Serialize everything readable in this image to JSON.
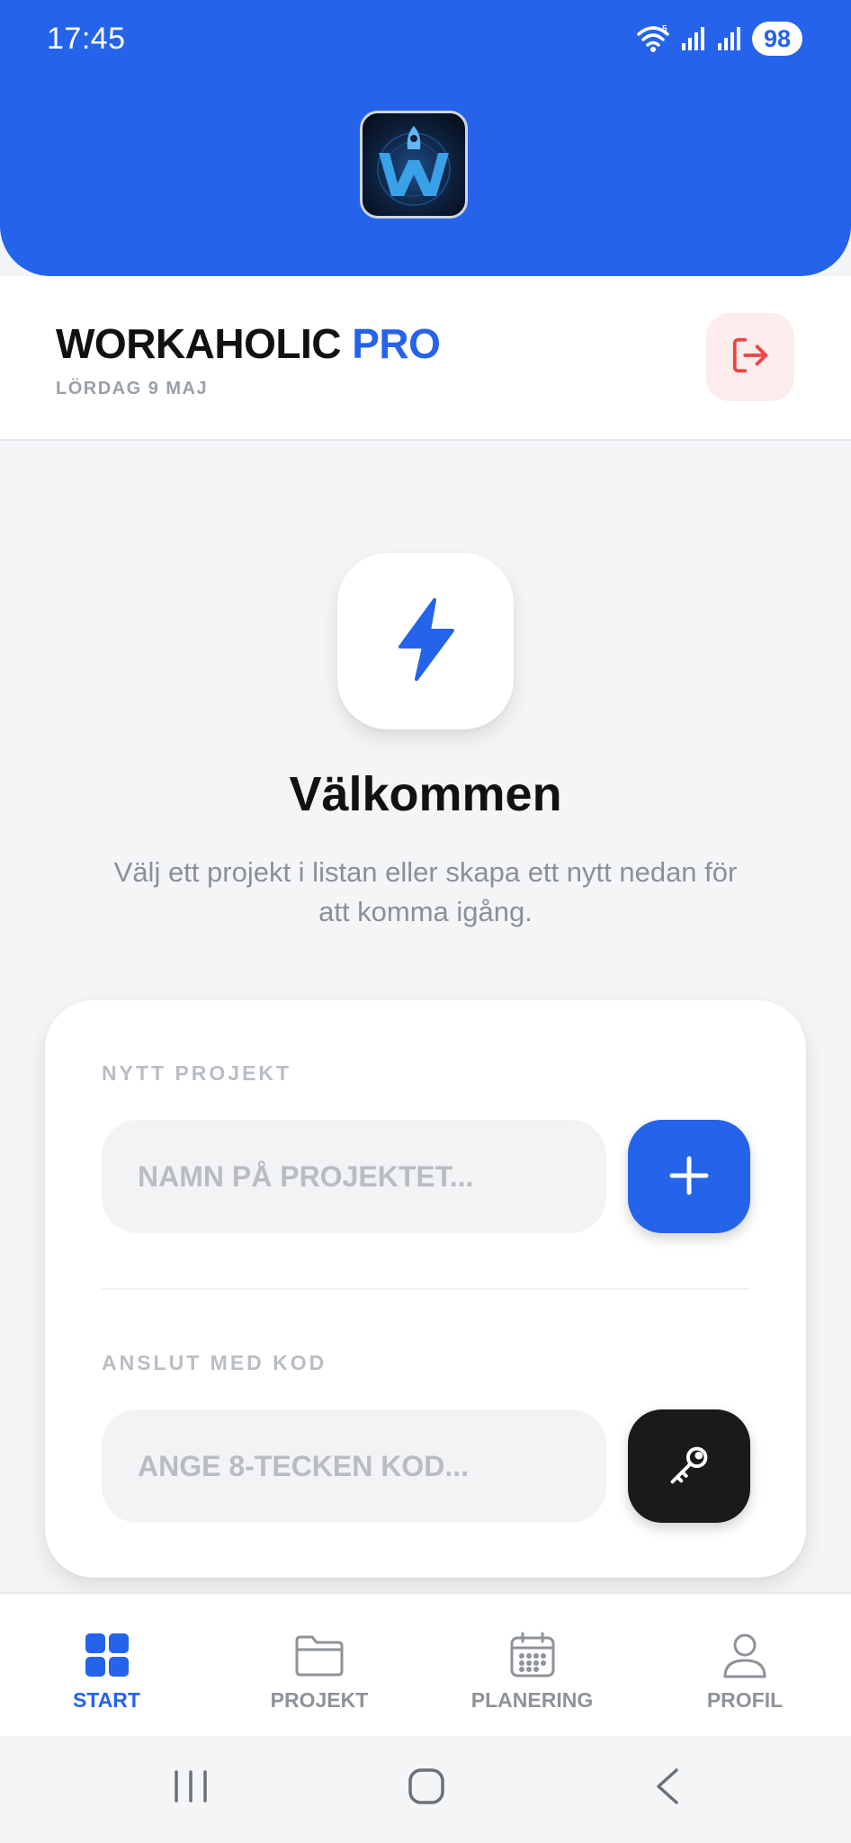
{
  "status_bar": {
    "time": "17:45",
    "battery": "98",
    "icons": [
      "wifi-icon",
      "signal-icon",
      "signal-icon",
      "battery-icon"
    ]
  },
  "header": {
    "logo": "workaholic-logo",
    "title_main": "WORKAHOLIC ",
    "title_accent": "PRO",
    "date": "LÖRDAG 9 MAJ",
    "logout_icon": "logout-icon"
  },
  "welcome": {
    "icon": "lightning-icon",
    "title": "Välkommen",
    "text": "Välj ett projekt i listan eller skapa ett nytt nedan för att komma igång."
  },
  "new_project": {
    "label": "NYTT PROJEKT",
    "value": "",
    "placeholder": "NAMN PÅ PROJEKTET...",
    "button_icon": "plus-icon"
  },
  "join_code": {
    "label": "ANSLUT MED KOD",
    "value": "",
    "placeholder": "ANGE 8-TECKEN KOD...",
    "button_icon": "key-icon"
  },
  "bottom_nav": [
    {
      "label": "START",
      "icon": "grid-icon",
      "active": true
    },
    {
      "label": "PROJEKT",
      "icon": "folder-icon",
      "active": false
    },
    {
      "label": "PLANERING",
      "icon": "calendar-icon",
      "active": false
    },
    {
      "label": "PROFIL",
      "icon": "user-icon",
      "active": false
    }
  ],
  "colors": {
    "accent": "#2563eb",
    "background": "#f4f5f7",
    "logout_bg": "#fdecec",
    "logout_icon": "#ef4444",
    "key_button": "#1a1a1a",
    "muted_text": "#8b9098"
  }
}
